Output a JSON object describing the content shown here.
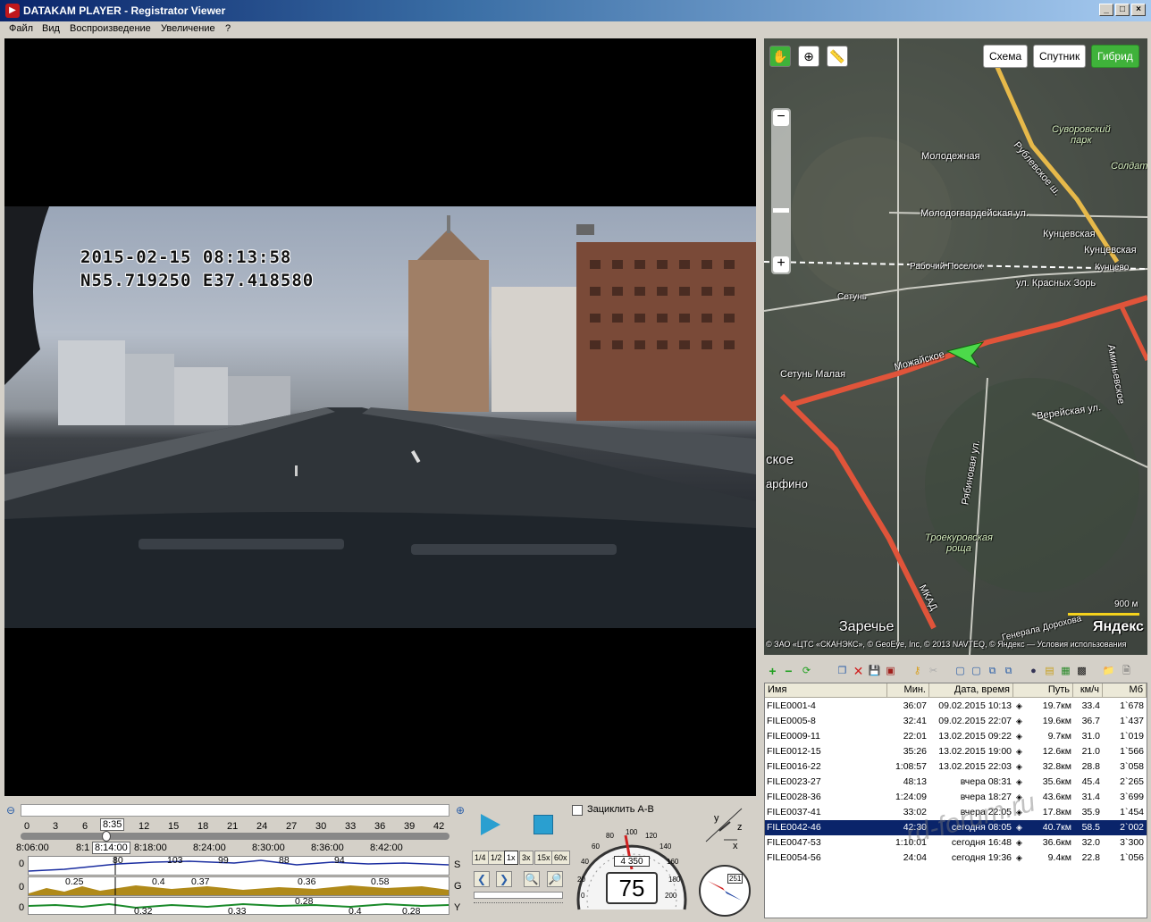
{
  "window": {
    "title": "DATAKAM PLAYER - Registrator Viewer",
    "icon": "app-logo-icon",
    "controls": [
      "_",
      "□",
      "×"
    ]
  },
  "menu": [
    "Файл",
    "Вид",
    "Воспроизведение",
    "Увеличение",
    "?"
  ],
  "video": {
    "overlay_datetime": "2015-02-15  08:13:58",
    "overlay_coords": "N55.719250  E37.418580"
  },
  "map": {
    "modes": [
      "Схема",
      "Спутник",
      "Гибрид"
    ],
    "active_mode": "Гибрид",
    "accent": "#3fb23a",
    "labels": {
      "suvorovsky": "Суворовский\nпарк",
      "soldat": "Солдат",
      "molodezhnaya": "Молодежная",
      "rublevskoe": "Рублевское ш.",
      "molodogvard": "Молодогвардейская ул.",
      "kuntsevskaya1": "Кунцевская",
      "kuntsevskaya2": "Кунцевская",
      "rabochiy": "Рабочий Поселок",
      "kuntsevo": "Кунцево",
      "setun": "Сетунь",
      "krasnyh_zor": "ул. Красных Зорь",
      "setun_malaya": "Сетунь Малая",
      "mozhayskoe": "Можайское",
      "aminevskoe": "Аминьевское",
      "vereyskaya": "Верейская ул.",
      "skoe": "ское",
      "arfino": "арфино",
      "ryabinovaya": "Рябиновая ул.",
      "troekurovskaya": "Троекуровская\nроща",
      "mkad": "МКАД",
      "zarechye": "Заречье",
      "generala": "Генерала Дорохова",
      "scale": "900 м",
      "yandex": "Яндекс",
      "copyright": "© ЗАО «ЦТС «СКАНЭКС», © GeoEye, Inc, © 2013 NAVTEQ, © Яндекс — Условия использования"
    }
  },
  "file_list": {
    "columns": [
      "Имя",
      "Мин.",
      "Дата, время",
      "Путь",
      "км/ч",
      "Мб"
    ],
    "rows": [
      {
        "name": "FILE0001-4",
        "min": "36:07",
        "datetime": "09.02.2015 10:13",
        "path": "19.7км",
        "speed": "33.4",
        "mb": "1`678"
      },
      {
        "name": "FILE0005-8",
        "min": "32:41",
        "datetime": "09.02.2015 22:07",
        "path": "19.6км",
        "speed": "36.7",
        "mb": "1`437"
      },
      {
        "name": "FILE0009-11",
        "min": "22:01",
        "datetime": "13.02.2015 09:22",
        "path": "9.7км",
        "speed": "31.0",
        "mb": "1`019"
      },
      {
        "name": "FILE0012-15",
        "min": "35:26",
        "datetime": "13.02.2015 19:00",
        "path": "12.6км",
        "speed": "21.0",
        "mb": "1`566"
      },
      {
        "name": "FILE0016-22",
        "min": "1:08:57",
        "datetime": "13.02.2015 22:03",
        "path": "32.8км",
        "speed": "28.8",
        "mb": "3`058"
      },
      {
        "name": "FILE0023-27",
        "min": "48:13",
        "datetime": "вчера 08:31",
        "path": "35.6км",
        "speed": "45.4",
        "mb": "2`265"
      },
      {
        "name": "FILE0028-36",
        "min": "1:24:09",
        "datetime": "вчера 18:27",
        "path": "43.6км",
        "speed": "31.4",
        "mb": "3`699"
      },
      {
        "name": "FILE0037-41",
        "min": "33:02",
        "datetime": "вчера 22:05",
        "path": "17.8км",
        "speed": "35.9",
        "mb": "1`454"
      },
      {
        "name": "FILE0042-46",
        "min": "42:30",
        "datetime": "сегодня 08:05",
        "path": "40.7км",
        "speed": "58.5",
        "mb": "2`002",
        "selected": true
      },
      {
        "name": "FILE0047-53",
        "min": "1:10:01",
        "datetime": "сегодня 16:48",
        "path": "36.6км",
        "speed": "32.0",
        "mb": "3`300"
      },
      {
        "name": "FILE0054-56",
        "min": "24:04",
        "datetime": "сегодня 19:36",
        "path": "9.4км",
        "speed": "22.8",
        "mb": "1`056"
      }
    ]
  },
  "timeline": {
    "ticks": [
      "0",
      "3",
      "6",
      "12",
      "15",
      "18",
      "21",
      "24",
      "27",
      "30",
      "33",
      "36",
      "39",
      "42"
    ],
    "position_label": "8:35",
    "times": [
      "8:06:00",
      "8:1",
      "8:18:00",
      "8:24:00",
      "8:30:00",
      "8:36:00",
      "8:42:00"
    ],
    "current_time": "8:14:00",
    "progress": 0.2
  },
  "graphs": {
    "speed": {
      "letter": "S",
      "zero": "0",
      "values": [
        "80",
        "103",
        "99",
        "88",
        "94"
      ]
    },
    "g": {
      "letter": "G",
      "zero": "0",
      "values": [
        "0.25",
        "0.4",
        "0.37",
        "0.36",
        "0.58"
      ]
    },
    "y": {
      "letter": "Y",
      "zero": "0",
      "values": [
        "0.32",
        "0.33",
        "0.28",
        "0.4",
        "0.28"
      ]
    }
  },
  "playback": {
    "loop_label": "Зациклить A-B",
    "speeds": [
      "1/4",
      "1/2",
      "1x",
      "3x",
      "15x",
      "60x"
    ],
    "active_speed": "1x"
  },
  "speedometer": {
    "speed": "75",
    "odometer": "4 350",
    "scale": [
      "0",
      "20",
      "40",
      "60",
      "80",
      "100",
      "120",
      "140",
      "160",
      "180",
      "200"
    ]
  },
  "axes_widget": {
    "x": "x",
    "y": "y",
    "z": "z"
  },
  "compass": {
    "heading": "251"
  },
  "watermark": "rd-forum.ru"
}
